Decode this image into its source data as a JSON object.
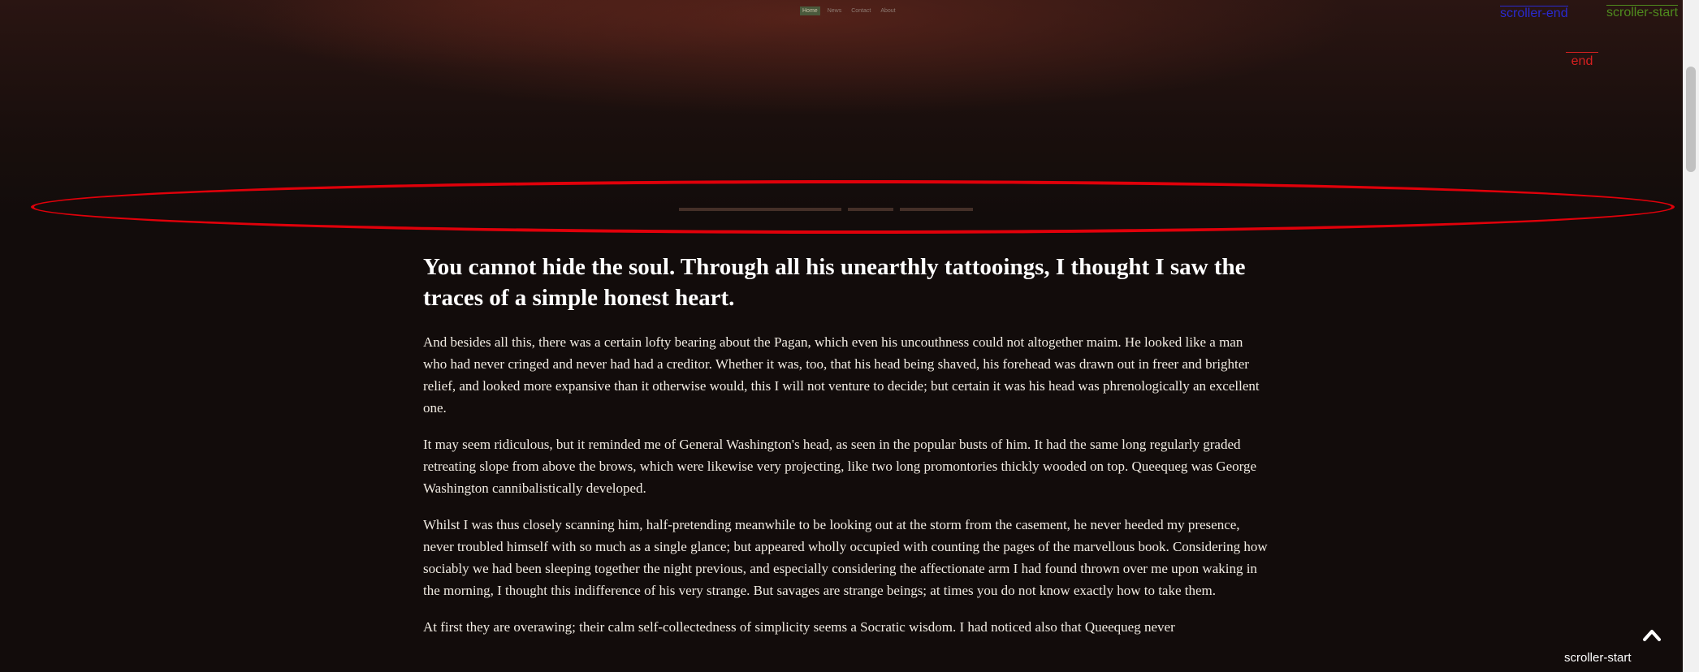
{
  "nav": {
    "items": [
      "Home",
      "News",
      "Contact",
      "About"
    ],
    "active_index": 0
  },
  "article": {
    "heading": "You cannot hide the soul. Through all his unearthly tattooings, I thought I saw the traces of a simple honest heart.",
    "paragraphs": [
      "And besides all this, there was a certain lofty bearing about the Pagan, which even his uncouthness could not altogether maim. He looked like a man who had never cringed and never had had a creditor. Whether it was, too, that his head being shaved, his forehead was drawn out in freer and brighter relief, and looked more expansive than it otherwise would, this I will not venture to decide; but certain it was his head was phrenologically an excellent one.",
      "It may seem ridiculous, but it reminded me of General Washington's head, as seen in the popular busts of him. It had the same long regularly graded retreating slope from above the brows, which were likewise very projecting, like two long promontories thickly wooded on top. Queequeg was George Washington cannibalistically developed.",
      "Whilst I was thus closely scanning him, half-pretending meanwhile to be looking out at the storm from the casement, he never heeded my presence, never troubled himself with so much as a single glance; but appeared wholly occupied with counting the pages of the marvellous book. Considering how sociably we had been sleeping together the night previous, and especially considering the affectionate arm I had found thrown over me upon waking in the morning, I thought this indifference of his very strange. But savages are strange beings; at times you do not know exactly how to take them.",
      "At first they are overawing; their calm self-collectedness of simplicity seems a Socratic wisdom. I had noticed also that Queequeg never"
    ]
  },
  "markers": {
    "scroller_end": "scroller-end",
    "scroller_start": "scroller-start",
    "end": "end",
    "scroller_start_bottom": "scroller-start"
  },
  "colors": {
    "background": "#120c0b",
    "highlight": "#e0000a",
    "text": "#f1ebe2"
  },
  "icons": {
    "back_to_top": "chevron-up-icon"
  }
}
